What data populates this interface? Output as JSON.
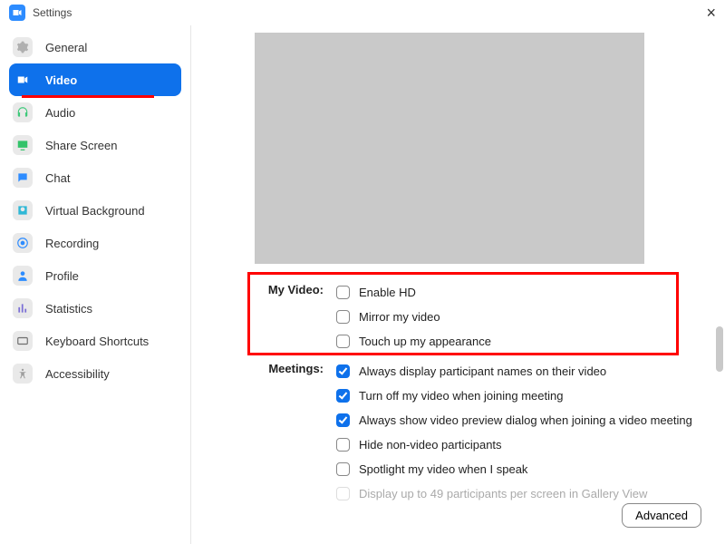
{
  "title": "Settings",
  "sidebar": {
    "items": [
      {
        "label": "General"
      },
      {
        "label": "Video"
      },
      {
        "label": "Audio"
      },
      {
        "label": "Share Screen"
      },
      {
        "label": "Chat"
      },
      {
        "label": "Virtual Background"
      },
      {
        "label": "Recording"
      },
      {
        "label": "Profile"
      },
      {
        "label": "Statistics"
      },
      {
        "label": "Keyboard Shortcuts"
      },
      {
        "label": "Accessibility"
      }
    ]
  },
  "video": {
    "my_video_label": "My Video:",
    "meetings_label": "Meetings:",
    "my_video": [
      {
        "label": "Enable HD",
        "checked": false
      },
      {
        "label": "Mirror my video",
        "checked": false
      },
      {
        "label": "Touch up my appearance",
        "checked": false
      }
    ],
    "meetings": [
      {
        "label": "Always display participant names on their video",
        "checked": true
      },
      {
        "label": "Turn off my video when joining meeting",
        "checked": true
      },
      {
        "label": "Always show video preview dialog when joining a video meeting",
        "checked": true
      },
      {
        "label": "Hide non-video participants",
        "checked": false
      },
      {
        "label": "Spotlight my video when I speak",
        "checked": false
      },
      {
        "label": "Display up to 49 participants per screen in Gallery View",
        "checked": false,
        "disabled": true
      }
    ]
  },
  "advanced_label": "Advanced"
}
